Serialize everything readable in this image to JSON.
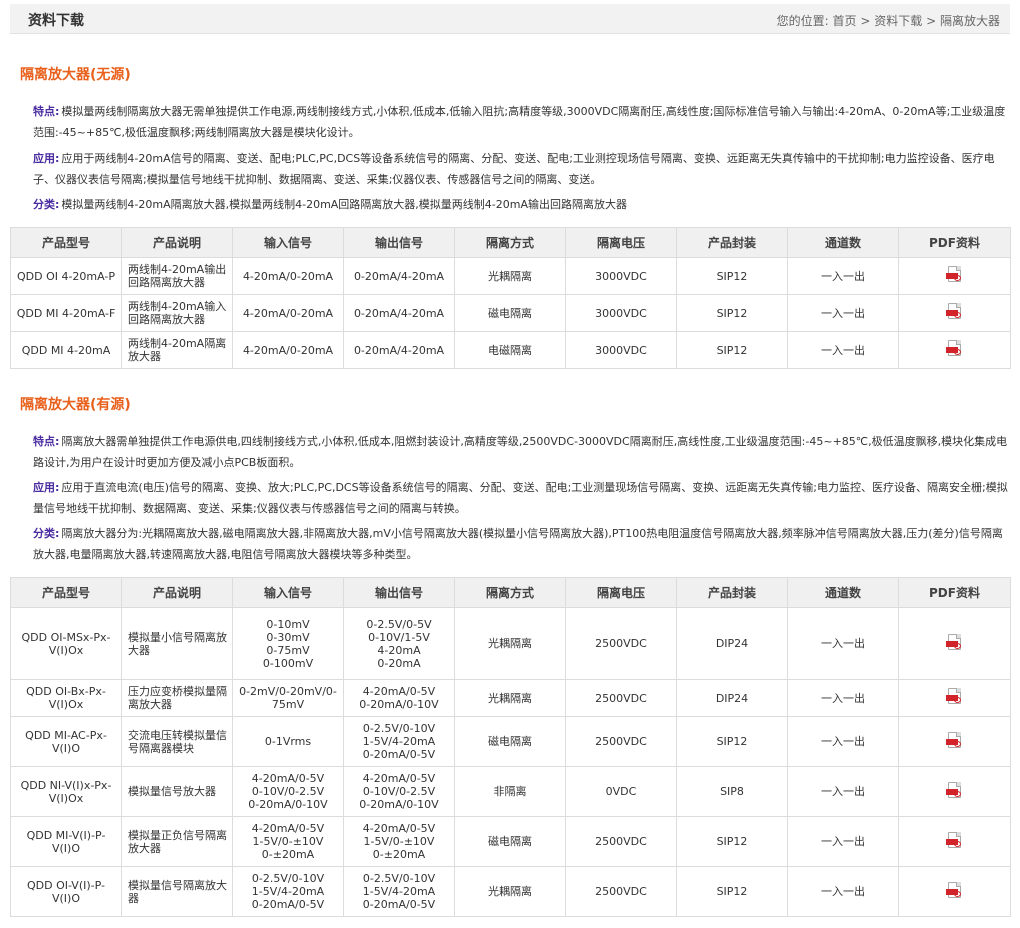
{
  "header": {
    "title": "资料下载",
    "breadcrumb_prefix": "您的位置:",
    "breadcrumb": [
      "首页",
      "资料下载",
      "隔离放大器"
    ],
    "separator": ">"
  },
  "sections": [
    {
      "title": "隔离放大器(无源)",
      "feature_key": "特点:",
      "feature_text": "模拟量两线制隔离放大器无需单独提供工作电源,两线制接线方式,小体积,低成本,低输入阻抗;高精度等级,3000VDC隔离耐压,高线性度;国际标准信号输入与输出:4-20mA、0-20mA等;工业级温度范围:-45~+85℃,极低温度飘移;两线制隔离放大器是模块化设计。",
      "app_key": "应用:",
      "app_text": "应用于两线制4-20mA信号的隔离、变送、配电;PLC,PC,DCS等设备系统信号的隔离、分配、变送、配电;工业测控现场信号隔离、变换、远距离无失真传输中的干扰抑制;电力监控设备、医疗电子、仪器仪表信号隔离;模拟量信号地线干扰抑制、数据隔离、变送、采集;仪器仪表、传感器信号之间的隔离、变送。",
      "class_key": "分类:",
      "class_text": "模拟量两线制4-20mA隔离放大器,模拟量两线制4-20mA回路隔离放大器,模拟量两线制4-20mA输出回路隔离放大器",
      "columns": [
        "产品型号",
        "产品说明",
        "输入信号",
        "输出信号",
        "隔离方式",
        "隔离电压",
        "产品封装",
        "通道数",
        "PDF资料"
      ],
      "rows": [
        {
          "model": "QDD OI 4-20mA-P",
          "desc": "两线制4-20mA输出回路隔离放大器",
          "input": "4-20mA/0-20mA",
          "output": "0-20mA/4-20mA",
          "isolation": "光耦隔离",
          "voltage": "3000VDC",
          "package": "SIP12",
          "channels": "一入一出"
        },
        {
          "model": "QDD MI 4-20mA-F",
          "desc": "两线制4-20mA输入回路隔离放大器",
          "input": "4-20mA/0-20mA",
          "output": "0-20mA/4-20mA",
          "isolation": "磁电隔离",
          "voltage": "3000VDC",
          "package": "SIP12",
          "channels": "一入一出"
        },
        {
          "model": "QDD MI 4-20mA",
          "desc": "两线制4-20mA隔离放大器",
          "input": "4-20mA/0-20mA",
          "output": "0-20mA/4-20mA",
          "isolation": "电磁隔离",
          "voltage": "3000VDC",
          "package": "SIP12",
          "channels": "一入一出"
        }
      ]
    },
    {
      "title": "隔离放大器(有源)",
      "feature_key": "特点:",
      "feature_text": "隔离放大器需单独提供工作电源供电,四线制接线方式,小体积,低成本,阻燃封装设计,高精度等级,2500VDC-3000VDC隔离耐压,高线性度,工业级温度范围:-45~+85℃,极低温度飘移,模块化集成电路设计,为用户在设计时更加方便及减小点PCB板面积。",
      "app_key": "应用:",
      "app_text": "应用于直流电流(电压)信号的隔离、变换、放大;PLC,PC,DCS等设备系统信号的隔离、分配、变送、配电;工业测量现场信号隔离、变换、远距离无失真传输;电力监控、医疗设备、隔离安全栅;模拟量信号地线干扰抑制、数据隔离、变送、采集;仪器仪表与传感器信号之间的隔离与转换。",
      "class_key": "分类:",
      "class_text": "隔离放大器分为:光耦隔离放大器,磁电隔离放大器,非隔离放大器,mV小信号隔离放大器(模拟量小信号隔离放大器),PT100热电阻温度信号隔离放大器,频率脉冲信号隔离放大器,压力(差分)信号隔离放大器,电量隔离放大器,转速隔离放大器,电阻信号隔离放大器模块等多种类型。",
      "columns": [
        "产品型号",
        "产品说明",
        "输入信号",
        "输出信号",
        "隔离方式",
        "隔离电压",
        "产品封装",
        "通道数",
        "PDF资料"
      ],
      "rows": [
        {
          "model": "QDD OI-MSx-Px-V(I)Ox",
          "desc": "模拟量小信号隔离放大器",
          "input": "0-10mV\n0-30mV\n0-75mV\n0-100mV",
          "output": "0-2.5V/0-5V\n0-10V/1-5V\n4-20mA\n0-20mA",
          "isolation": "光耦隔离",
          "voltage": "2500VDC",
          "package": "DIP24",
          "channels": "一入一出"
        },
        {
          "model": "QDD OI-Bx-Px-V(I)Ox",
          "desc": "压力应变桥模拟量隔离放大器",
          "input": "0-2mV/0-20mV/0-75mV",
          "output": "4-20mA/0-5V\n0-20mA/0-10V",
          "isolation": "光耦隔离",
          "voltage": "2500VDC",
          "package": "DIP24",
          "channels": "一入一出"
        },
        {
          "model": "QDD MI-AC-Px-V(I)O",
          "desc": "交流电压转模拟量信号隔离器模块",
          "input": "0-1Vrms",
          "output": "0-2.5V/0-10V\n1-5V/4-20mA\n0-20mA/0-5V",
          "isolation": "磁电隔离",
          "voltage": "2500VDC",
          "package": "SIP12",
          "channels": "一入一出"
        },
        {
          "model": "QDD NI-V(I)x-Px-V(I)Ox",
          "desc": "模拟量信号放大器",
          "input": "4-20mA/0-5V\n0-10V/0-2.5V\n0-20mA/0-10V",
          "output": "4-20mA/0-5V\n0-10V/0-2.5V\n0-20mA/0-10V",
          "isolation": "非隔离",
          "voltage": "0VDC",
          "package": "SIP8",
          "channels": "一入一出"
        },
        {
          "model": "QDD MI-V(I)-P-V(I)O",
          "desc": "模拟量正负信号隔离放大器",
          "input": "4-20mA/0-5V\n1-5V/0-±10V\n0-±20mA",
          "output": "4-20mA/0-5V\n1-5V/0-±10V\n0-±20mA",
          "isolation": "磁电隔离",
          "voltage": "2500VDC",
          "package": "SIP12",
          "channels": "一入一出"
        },
        {
          "model": "QDD OI-V(I)-P-V(I)O",
          "desc": "模拟量信号隔离放大器",
          "input": "0-2.5V/0-10V\n1-5V/4-20mA\n0-20mA/0-5V",
          "output": "0-2.5V/0-10V\n1-5V/4-20mA\n0-20mA/0-5V",
          "isolation": "光耦隔离",
          "voltage": "2500VDC",
          "package": "SIP12",
          "channels": "一入一出"
        }
      ]
    }
  ],
  "pdf_icon": "pdf-file-icon",
  "colors": {
    "section_title": "#e8601c",
    "label": "#4a2ca0",
    "pdf_red": "#d2232a"
  }
}
